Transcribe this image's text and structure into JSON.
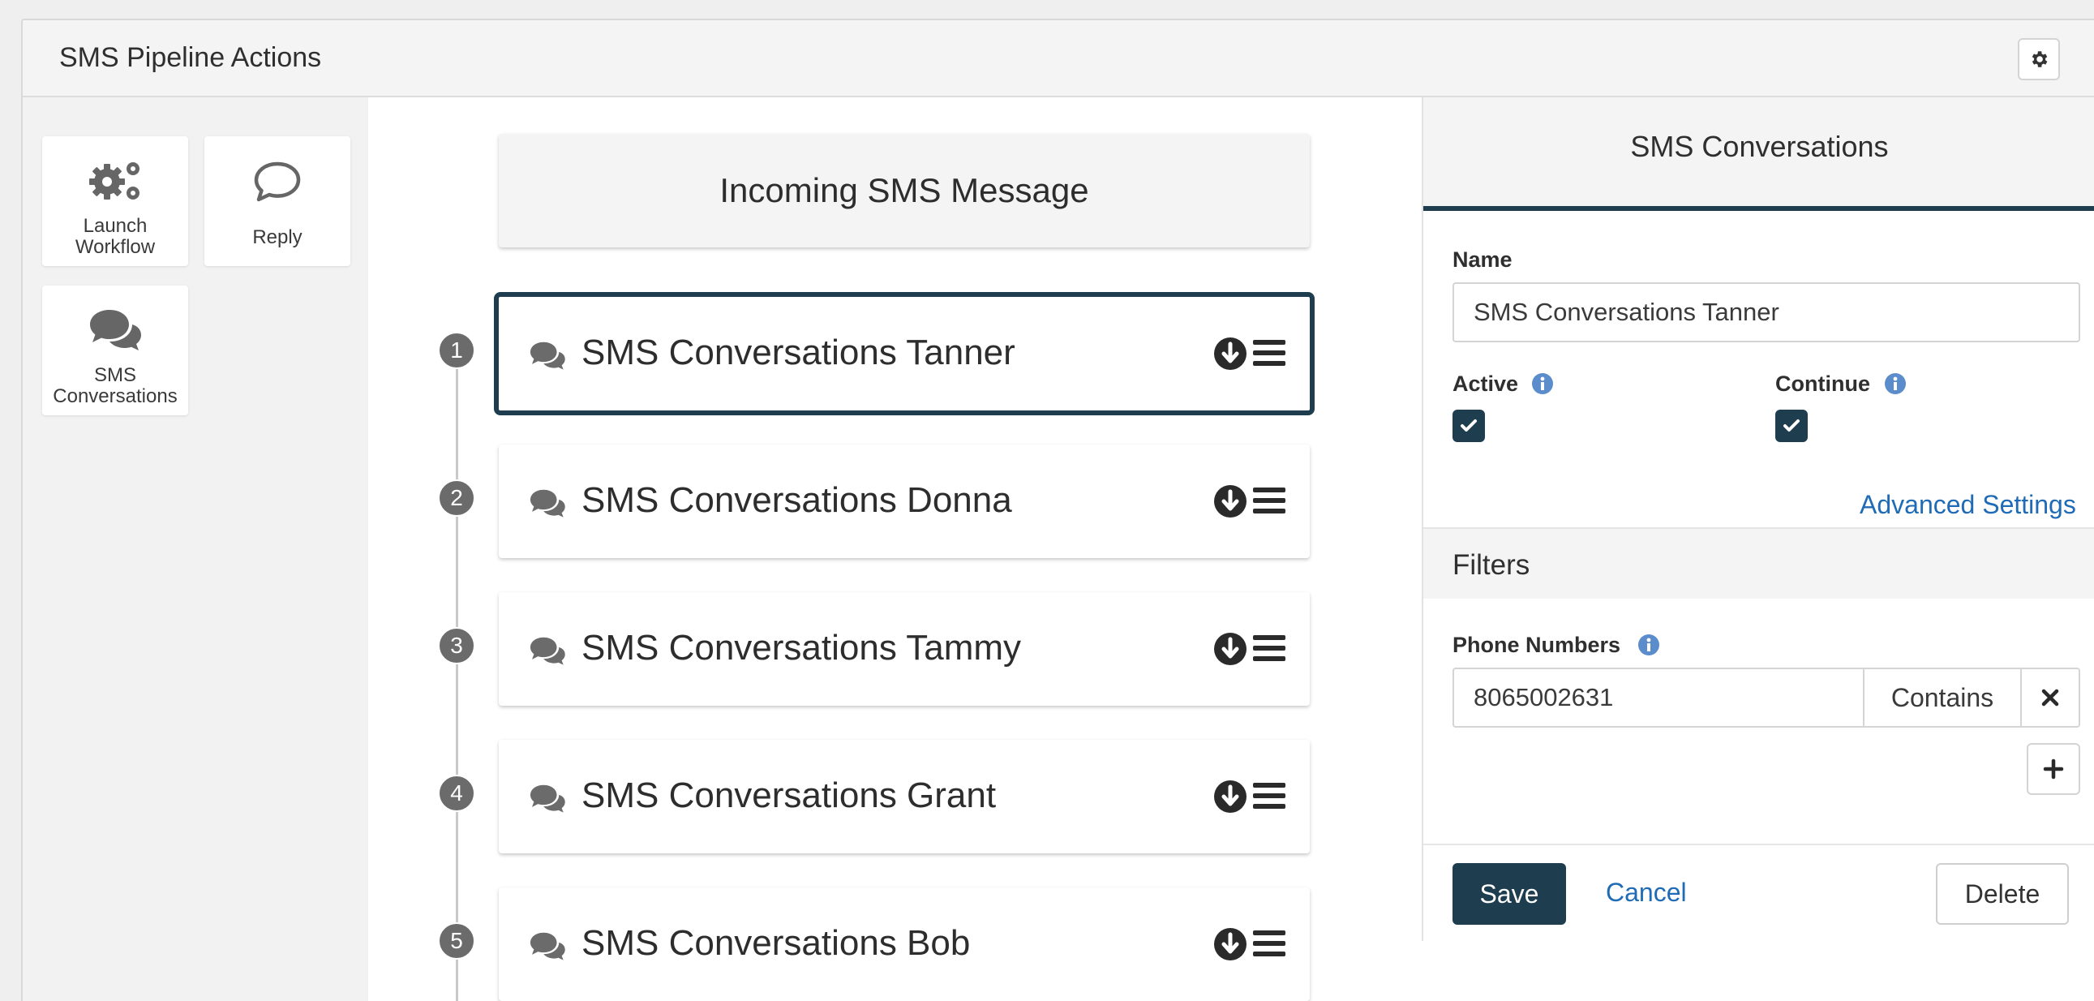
{
  "header": {
    "title": "SMS Pipeline Actions",
    "settings_icon": "gear-icon"
  },
  "actions": [
    {
      "label_line1": "Launch",
      "label_line2": "Workflow",
      "icon": "gears-icon"
    },
    {
      "label_line1": "Reply",
      "label_line2": "",
      "icon": "speech-bubble-icon"
    },
    {
      "label_line1": "SMS",
      "label_line2": "Conversations",
      "icon": "comments-icon"
    }
  ],
  "trigger": {
    "label": "Incoming SMS Message"
  },
  "steps": [
    {
      "number": "1",
      "name": "SMS Conversations Tanner",
      "selected": true
    },
    {
      "number": "2",
      "name": "SMS Conversations Donna",
      "selected": false
    },
    {
      "number": "3",
      "name": "SMS Conversations Tammy",
      "selected": false
    },
    {
      "number": "4",
      "name": "SMS Conversations Grant",
      "selected": false
    },
    {
      "number": "5",
      "name": "SMS Conversations Bob",
      "selected": false
    }
  ],
  "detail": {
    "title": "SMS Conversations",
    "name_label": "Name",
    "name_value": "SMS Conversations Tanner",
    "active_label": "Active",
    "active_checked": true,
    "continue_label": "Continue",
    "continue_checked": true,
    "advanced_link": "Advanced Settings",
    "filters_title": "Filters",
    "phone_label": "Phone Numbers",
    "phone_value": "8065002631",
    "phone_operator": "Contains",
    "save_label": "Save",
    "cancel_label": "Cancel",
    "delete_label": "Delete"
  },
  "colors": {
    "primary": "#1e3d4f",
    "link": "#1f6bb5",
    "info": "#5b8ccc",
    "step_badge": "#6b6b6b"
  }
}
